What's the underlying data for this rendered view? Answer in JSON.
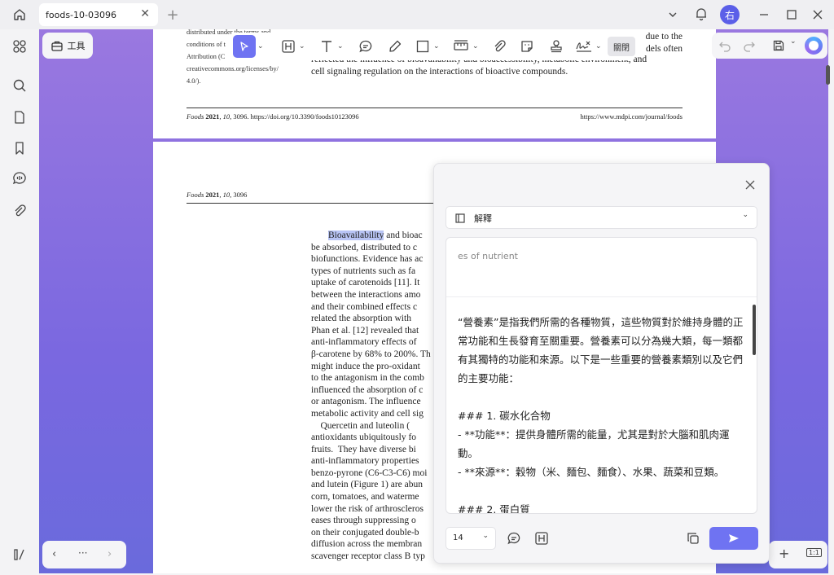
{
  "tab": {
    "title": "foods-10-03096"
  },
  "toolbar": {
    "tools_label": "工具",
    "close_label": "關閉"
  },
  "page1": {
    "license_lines": [
      "distributed under the terms and",
      "conditions of t",
      "Attribution (C",
      "creativecommons.org/licenses/by/",
      "4.0/)."
    ],
    "right_lines": [
      "due to the",
      "dels often"
    ],
    "main_lines": [
      "reflected the influence of bioavailability and bioaccessibility, metabolic environment, and",
      "cell signaling regulation on the interactions of bioactive compounds."
    ],
    "footer_left_journal": "Foods",
    "footer_left_year": "2021",
    "footer_left_vol": "10",
    "footer_left_rest": ", 3096. https://doi.org/10.3390/foods10123096",
    "footer_right": "https://www.mdpi.com/journal/foods"
  },
  "page2": {
    "header_journal": "Foods",
    "header_year": "2021",
    "header_vol": "10",
    "header_rest": ", 3096",
    "highlight": "Bioavailability",
    "first_rest": " and bioac",
    "lines": [
      "be absorbed, distributed to c",
      "biofunctions. Evidence has ac",
      "types of nutrients such as fa",
      "uptake of carotenoids [11]. It",
      "between the interactions amo",
      "and their combined effects c",
      "related the absorption with",
      "Phan et al. [12] revealed that",
      "anti-inflammatory effects of",
      "β-carotene by 68% to 200%. Th",
      "might induce the pro-oxidant",
      "to the antagonism in the comb",
      "influenced the absorption of c",
      "or antagonism. The influence",
      "metabolic activity and cell sig",
      "    Quercetin and luteolin (",
      "antioxidants ubiquitously fo",
      "fruits.  They have diverse bi",
      "anti-inflammatory properties",
      "benzo-pyrone (C6-C3-C6) moi",
      "and lutein (Figure 1) are abun",
      "corn, tomatoes, and waterme",
      "lower the risk of arthroscleros",
      "eases through suppressing o",
      "on their conjugated double-b",
      "diffusion across the membran",
      "scavenger receptor class B typ"
    ]
  },
  "ai_panel": {
    "mode_label": "解釋",
    "source_text": "es of nutrient",
    "answer_lines": [
      "“營養素”是指我們所需的各種物質，這些物質對於維持身體的正",
      "常功能和生長發育至關重要。營養素可以分為幾大類，每一類都",
      "有其獨特的功能和來源。以下是一些重要的營養素類別以及它們",
      "的主要功能：",
      "",
      "### 1. 碳水化合物",
      "- **功能**：提供身體所需的能量，尤其是對於大腦和肌肉運",
      "動。",
      "- **來源**：穀物（米、麵包、麵食）、水果、蔬菜和豆類。",
      "",
      "### 2. 蛋白質"
    ],
    "font_size": "14"
  },
  "avatar": {
    "label": "右"
  },
  "nav": {
    "more": "···",
    "zoom_ratio": "1:1"
  },
  "colors": {
    "accent": "#6f73f2",
    "highlight": "#b8c4f4",
    "bg_gradient_top": "#9a78e0"
  }
}
